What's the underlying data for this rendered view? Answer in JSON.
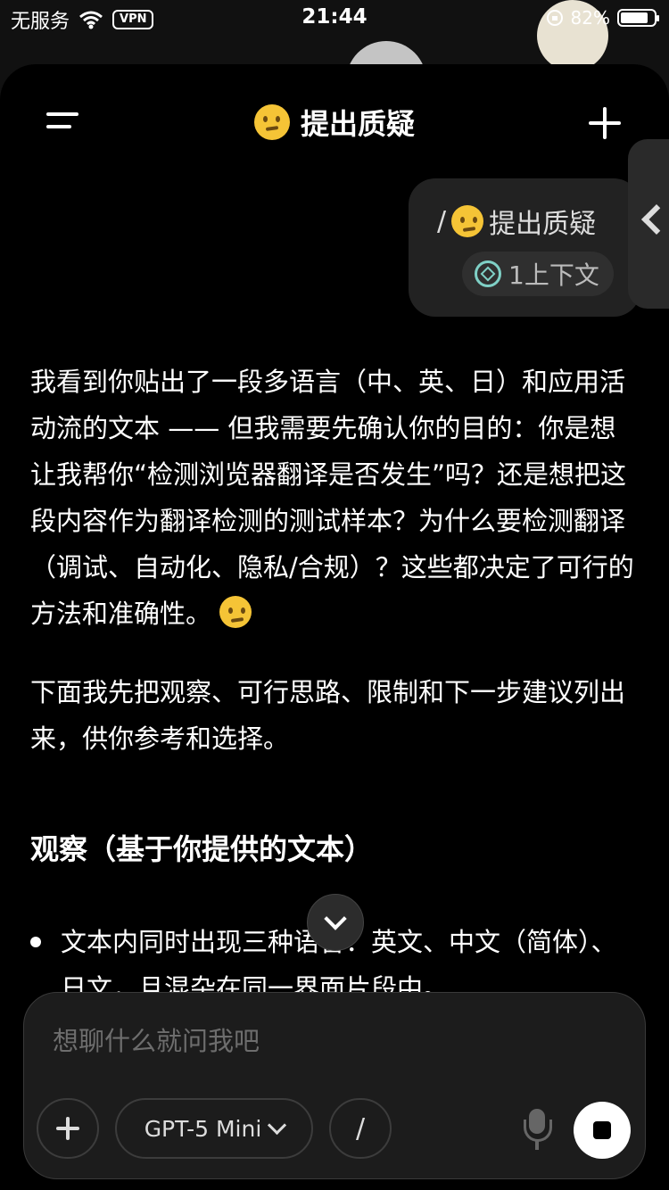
{
  "status_bar": {
    "carrier": "无服务",
    "vpn": "VPN",
    "time": "21:44",
    "battery": "82%"
  },
  "header": {
    "title": "提出质疑",
    "emoji": "thinking-face"
  },
  "user_message": {
    "text": "/ 提出质疑",
    "prefix": "/",
    "label": "提出质疑",
    "context_chip": "1上下文"
  },
  "assistant": {
    "paragraphs": [
      "我看到你贴出了一段多语言（中、英、日）和应用活动流的文本 —— 但我需要先确认你的目的：你是想让我帮你“检测浏览器翻译是否发生”吗？还是想把这段内容作为翻译检测的测试样本？为什么要检测翻译（调试、自动化、隐私/合规）？这些都决定了可行的方法和准确性。",
      "下面我先把观察、可行思路、限制和下一步建议列出来，供你参考和选择。"
    ],
    "section_heading": "观察（基于你提供的文本）",
    "bullets": [
      "文本内同时出现三种语言：英文、中文（简体）、日文，且混杂在同一界面片段中。"
    ]
  },
  "composer": {
    "placeholder": "想聊什么就问我吧",
    "model": "GPT-5 Mini",
    "slash": "/"
  }
}
